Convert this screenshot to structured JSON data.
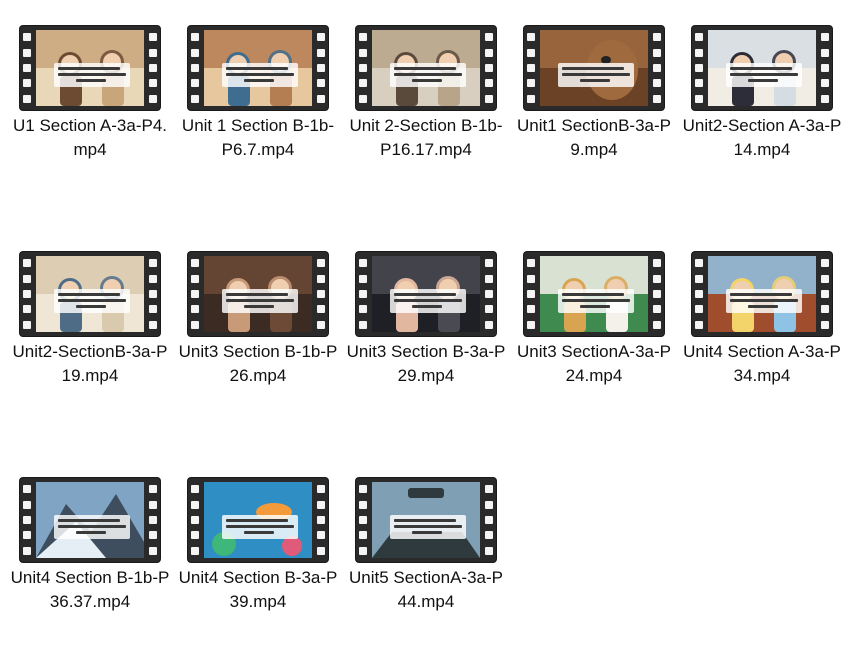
{
  "files": [
    {
      "name": "U1 Section A-3a-P4.mp4",
      "icon": "video-file-icon",
      "scene": "classroom-warm",
      "palette": [
        "#c9a57a",
        "#6d4b33",
        "#e8d8b8"
      ]
    },
    {
      "name": "Unit 1 Section B-1b-P6.7.mp4",
      "icon": "video-file-icon",
      "scene": "study-room",
      "palette": [
        "#b57d52",
        "#3e6d8f",
        "#e7c79d"
      ]
    },
    {
      "name": "Unit 2-Section B-1b-P16.17.mp4",
      "icon": "video-file-icon",
      "scene": "office-reading",
      "palette": [
        "#b8a488",
        "#5a4a3c",
        "#d8cfc0"
      ]
    },
    {
      "name": "Unit1 SectionB-3a-P9.mp4",
      "icon": "video-file-icon",
      "scene": "horse-portrait",
      "palette": [
        "#a06a3f",
        "#e9d2a8",
        "#6b4225"
      ]
    },
    {
      "name": "Unit2-Section A-3a-P14.mp4",
      "icon": "video-file-icon",
      "scene": "clinic-room",
      "palette": [
        "#d5dde2",
        "#2d2d3a",
        "#f1ece4"
      ]
    },
    {
      "name": "Unit2-SectionB-3a-P19.mp4",
      "icon": "video-file-icon",
      "scene": "hospital-group",
      "palette": [
        "#d9c9ad",
        "#4f6c86",
        "#f0e6d6"
      ]
    },
    {
      "name": "Unit3 Section B-1b-P26.mp4",
      "icon": "video-file-icon",
      "scene": "friends-closeup",
      "palette": [
        "#6c4a36",
        "#c89a78",
        "#3b2b22"
      ]
    },
    {
      "name": "Unit3 Section B-3a-P29.mp4",
      "icon": "video-file-icon",
      "scene": "mother-daughter",
      "palette": [
        "#4a4a52",
        "#e2b7a0",
        "#1f1f26"
      ]
    },
    {
      "name": "Unit3 SectionA-3a-P24.mp4",
      "icon": "video-file-icon",
      "scene": "two-girls",
      "palette": [
        "#f4f1ea",
        "#d9a451",
        "#3f8a4e"
      ]
    },
    {
      "name": "Unit4 Section A-3a-P34.mp4",
      "icon": "video-file-icon",
      "scene": "girls-sunny",
      "palette": [
        "#8fc3e6",
        "#f2d46b",
        "#a04d2d"
      ]
    },
    {
      "name": "Unit4 Section B-1b-P36.37.mp4",
      "icon": "video-file-icon",
      "scene": "mountain-climb",
      "palette": [
        "#7fa4c4",
        "#e6eef5",
        "#3e4e5e"
      ]
    },
    {
      "name": "Unit4 Section B-3a-P39.mp4",
      "icon": "video-file-icon",
      "scene": "coral-reef",
      "palette": [
        "#2f8ec4",
        "#f39a3a",
        "#3fb77a"
      ]
    },
    {
      "name": "Unit5 SectionA-3a-P44.mp4",
      "icon": "video-file-icon",
      "scene": "car-windshield",
      "palette": [
        "#7e9fb4",
        "#2e3a3e",
        "#c8d6dd"
      ]
    }
  ]
}
